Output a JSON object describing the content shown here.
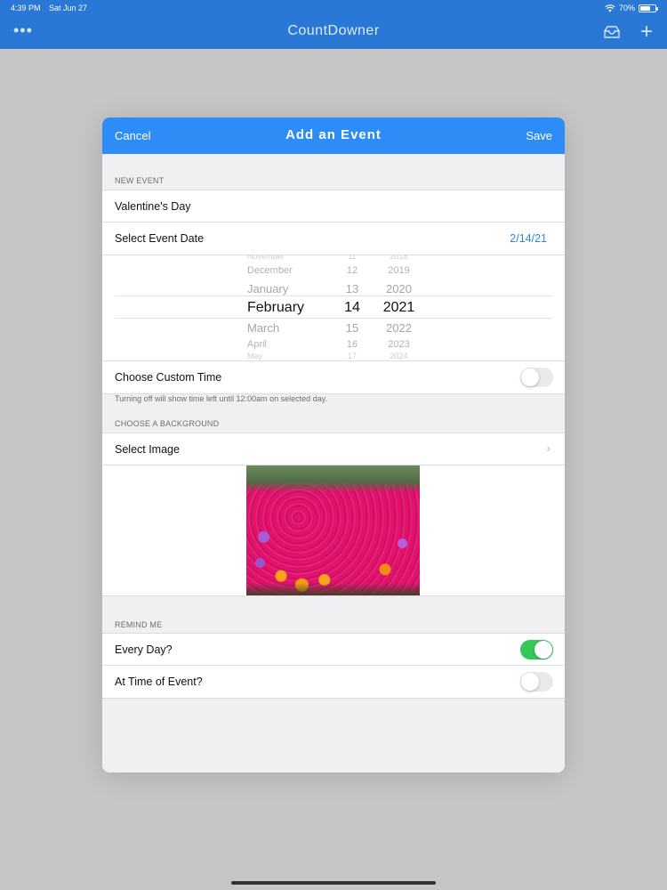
{
  "status_bar": {
    "time": "4:39 PM",
    "date": "Sat Jun 27",
    "battery": "70%",
    "battery_level": 0.7
  },
  "nav": {
    "title": "CountDowner",
    "more_label": "•••",
    "add_label": "+"
  },
  "modal": {
    "title": "Add an Event",
    "cancel_label": "Cancel",
    "save_label": "Save",
    "new_event": {
      "header": "NEW EVENT",
      "event_name": "Valentine's Day",
      "select_date_label": "Select Event Date",
      "selected_date": "2/14/21"
    },
    "picker": {
      "months": [
        "November",
        "December",
        "January",
        "February",
        "March",
        "April",
        "May"
      ],
      "days": [
        "11",
        "12",
        "13",
        "14",
        "15",
        "16",
        "17"
      ],
      "years": [
        "2018",
        "2019",
        "2020",
        "2021",
        "2022",
        "2023",
        "2024"
      ],
      "selected_index": 3
    },
    "custom_time": {
      "label": "Choose Custom Time",
      "enabled": false,
      "footnote": "Turning off will show time left until 12:00am on selected day."
    },
    "background": {
      "header": "CHOOSE A BACKGROUND",
      "select_image_label": "Select Image",
      "chevron": "›"
    },
    "remind": {
      "header": "REMIND ME",
      "every_day_label": "Every Day?",
      "every_day_enabled": true,
      "at_time_label": "At Time of Event?",
      "at_time_enabled": false
    }
  },
  "colors": {
    "nav_bar": "#2a78d6",
    "modal_header": "#2e8cf7",
    "accent": "#2e86e0",
    "toggle_on": "#34c759"
  }
}
